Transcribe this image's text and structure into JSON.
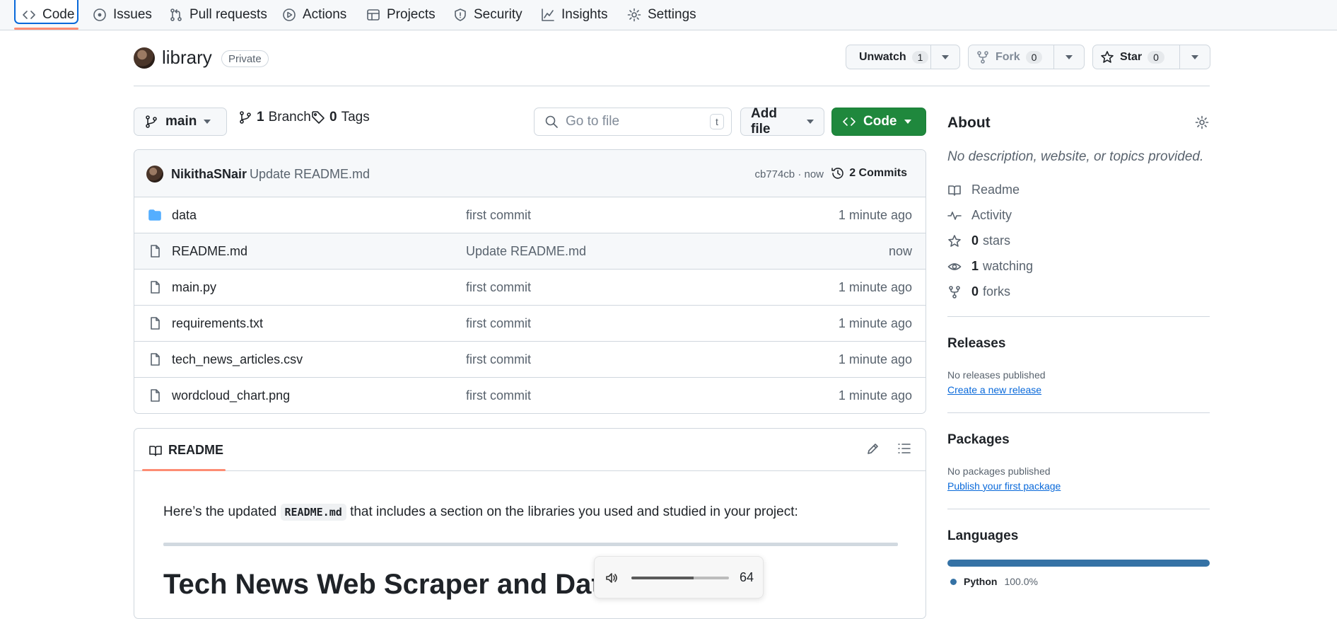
{
  "nav": {
    "tabs": [
      {
        "label": "Code",
        "icon": "code-icon"
      },
      {
        "label": "Issues",
        "icon": "issue-icon"
      },
      {
        "label": "Pull requests",
        "icon": "pull-request-icon"
      },
      {
        "label": "Actions",
        "icon": "play-icon"
      },
      {
        "label": "Projects",
        "icon": "table-icon"
      },
      {
        "label": "Security",
        "icon": "shield-icon"
      },
      {
        "label": "Insights",
        "icon": "graph-icon"
      },
      {
        "label": "Settings",
        "icon": "gear-icon"
      }
    ],
    "active_tab": "Code"
  },
  "repo": {
    "name": "library",
    "visibility": "Private",
    "unwatch": {
      "label": "Unwatch",
      "count": "1"
    },
    "fork": {
      "label": "Fork",
      "count": "0"
    },
    "star": {
      "label": "Star",
      "count": "0"
    }
  },
  "toolbar": {
    "branch": "main",
    "branches": {
      "count": "1",
      "label": "Branch"
    },
    "tags": {
      "count": "0",
      "label": "Tags"
    },
    "search_placeholder": "Go to file",
    "search_shortcut": "t",
    "add_file": "Add file",
    "code": "Code"
  },
  "commit": {
    "author": "NikithaSNair",
    "message": "Update README.md",
    "hash_time": "cb774cb · now",
    "commits_label": "2 Commits"
  },
  "files": [
    {
      "name": "data",
      "type": "folder",
      "message": "first commit",
      "time": "1 minute ago"
    },
    {
      "name": "README.md",
      "type": "file",
      "message": "Update README.md",
      "time": "now"
    },
    {
      "name": "main.py",
      "type": "file",
      "message": "first commit",
      "time": "1 minute ago"
    },
    {
      "name": "requirements.txt",
      "type": "file",
      "message": "first commit",
      "time": "1 minute ago"
    },
    {
      "name": "tech_news_articles.csv",
      "type": "file",
      "message": "first commit",
      "time": "1 minute ago"
    },
    {
      "name": "wordcloud_chart.png",
      "type": "file",
      "message": "first commit",
      "time": "1 minute ago"
    }
  ],
  "readme": {
    "tab_label": "README",
    "intro_before": "Here’s the updated",
    "intro_code": "README.md",
    "intro_after": "that includes a section on the libraries you used and studied in your project:",
    "heading": "Tech News Web Scraper and Data"
  },
  "volume": {
    "value": "64",
    "level": 0.64
  },
  "about": {
    "title": "About",
    "description": "No description, website, or topics provided.",
    "readme": "Readme",
    "activity": "Activity",
    "stars": {
      "count": "0",
      "label": "stars"
    },
    "watching": {
      "count": "1",
      "label": "watching"
    },
    "forks": {
      "count": "0",
      "label": "forks"
    }
  },
  "releases": {
    "title": "Releases",
    "note": "No releases published",
    "link": "Create a new release"
  },
  "packages": {
    "title": "Packages",
    "note": "No packages published",
    "link": "Publish your first package"
  },
  "languages": {
    "title": "Languages",
    "items": [
      {
        "name": "Python",
        "percent": "100.0%",
        "color": "#3572a5"
      }
    ]
  },
  "colors": {
    "accent": "#0969da",
    "code_button": "#1f883d",
    "tab_underline": "#fd8c73"
  }
}
